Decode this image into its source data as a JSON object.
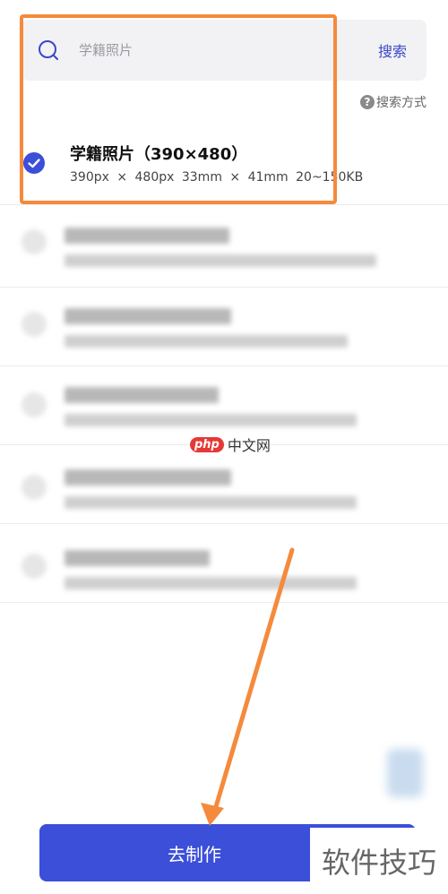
{
  "search": {
    "placeholder": "学籍照片",
    "button_label": "搜索"
  },
  "search_mode": {
    "icon_label": "?",
    "label": "搜索方式"
  },
  "selected_option": {
    "title": "学籍照片（390×480）",
    "spec": "390px × 480px   33mm × 41mm   20~150KB"
  },
  "watermarks": {
    "mid_logo": "php",
    "mid_text": "中文网",
    "corner_text": "软件技巧"
  },
  "primary_action": {
    "label": "去制作"
  },
  "colors": {
    "accent": "#3b4fd9",
    "annotation": "#f58a3c"
  }
}
